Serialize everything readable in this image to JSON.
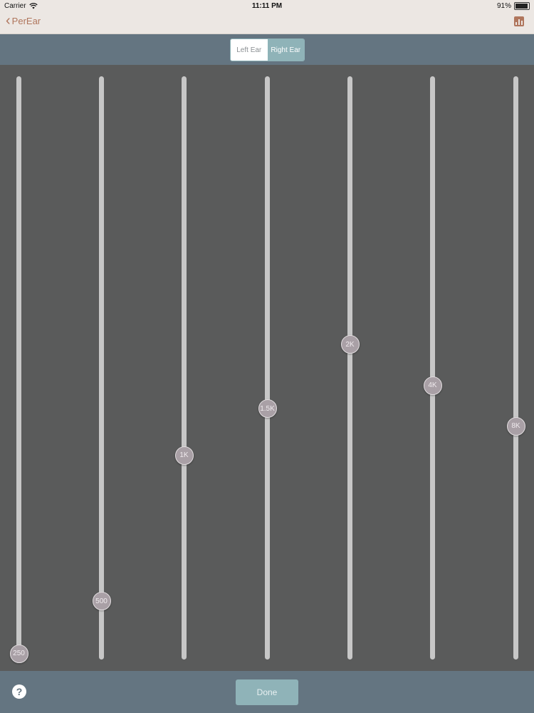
{
  "status_bar": {
    "carrier": "Carrier",
    "time": "11:11 PM",
    "battery": "91%",
    "battery_level": 0.91
  },
  "nav": {
    "back_label": "PerEar",
    "back_icon": "chevron-left-icon",
    "right_icon": "bar-chart-icon"
  },
  "segment": {
    "left_label": "Left Ear",
    "right_label": "Right Ear",
    "selected": "Right Ear"
  },
  "sliders": [
    {
      "label": "250",
      "value": 0.01
    },
    {
      "label": "500",
      "value": 0.1
    },
    {
      "label": "1K",
      "value": 0.35
    },
    {
      "label": "1.5K",
      "value": 0.43
    },
    {
      "label": "2K",
      "value": 0.54
    },
    {
      "label": "4K",
      "value": 0.47
    },
    {
      "label": "8K",
      "value": 0.4
    }
  ],
  "bottom": {
    "help_label": "?",
    "done_label": "Done"
  },
  "colors": {
    "accent": "#b0765d",
    "bar": "#647581",
    "button": "#8fb3b8",
    "background": "#5a5b5b"
  }
}
